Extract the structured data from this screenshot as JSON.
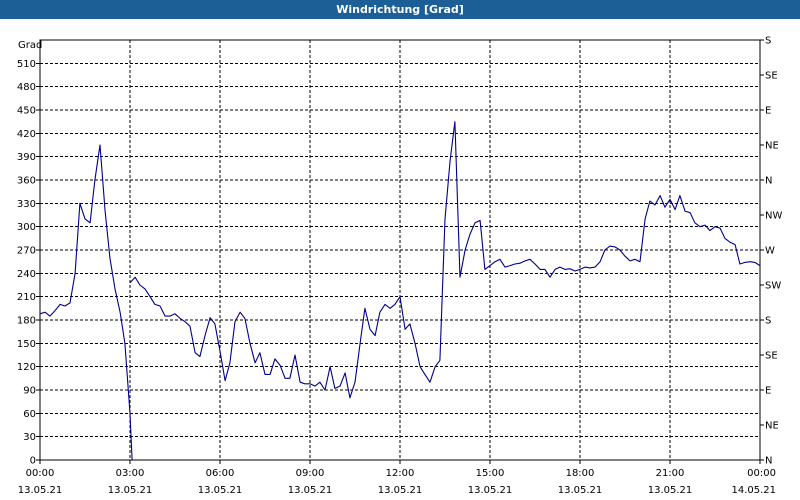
{
  "window": {
    "title": "Windrichtung [Grad]"
  },
  "chart_data": {
    "type": "line",
    "title": "Windrichtung [Grad]",
    "ylabel": "Grad",
    "ylim": [
      0,
      540
    ],
    "xlim_hours": [
      0,
      24
    ],
    "grid": true,
    "line_color": "#00008b",
    "y_ticks": [
      0,
      30,
      60,
      90,
      120,
      150,
      180,
      210,
      240,
      270,
      300,
      330,
      360,
      390,
      420,
      450,
      480,
      510
    ],
    "right_ticks": [
      {
        "value": 0,
        "label": "N"
      },
      {
        "value": 45,
        "label": "NE"
      },
      {
        "value": 90,
        "label": "E"
      },
      {
        "value": 135,
        "label": "SE"
      },
      {
        "value": 180,
        "label": "S"
      },
      {
        "value": 225,
        "label": "SW"
      },
      {
        "value": 270,
        "label": "W"
      },
      {
        "value": 315,
        "label": "NW"
      },
      {
        "value": 360,
        "label": "N"
      },
      {
        "value": 405,
        "label": "NE"
      },
      {
        "value": 450,
        "label": "E"
      },
      {
        "value": 495,
        "label": "SE"
      },
      {
        "value": 540,
        "label": "S"
      }
    ],
    "x_ticks": [
      {
        "hour": 0,
        "time": "00:00",
        "date": "13.05.21"
      },
      {
        "hour": 3,
        "time": "03:00",
        "date": "13.05.21"
      },
      {
        "hour": 6,
        "time": "06:00",
        "date": "13.05.21"
      },
      {
        "hour": 9,
        "time": "09:00",
        "date": "13.05.21"
      },
      {
        "hour": 12,
        "time": "12:00",
        "date": "13.05.21"
      },
      {
        "hour": 15,
        "time": "15:00",
        "date": "13.05.21"
      },
      {
        "hour": 18,
        "time": "18:00",
        "date": "13.05.21"
      },
      {
        "hour": 21,
        "time": "21:00",
        "date": "13.05.21"
      },
      {
        "hour": 24,
        "time": "00:00",
        "date": "14.05.21"
      }
    ],
    "series": [
      {
        "points": [
          [
            0.0,
            188
          ],
          [
            0.17,
            190
          ],
          [
            0.33,
            185
          ],
          [
            0.5,
            192
          ],
          [
            0.67,
            200
          ],
          [
            0.83,
            198
          ],
          [
            1.0,
            202
          ],
          [
            1.17,
            240
          ],
          [
            1.33,
            330
          ],
          [
            1.5,
            310
          ],
          [
            1.67,
            305
          ],
          [
            1.83,
            360
          ],
          [
            2.0,
            405
          ],
          [
            2.17,
            320
          ],
          [
            2.33,
            260
          ],
          [
            2.5,
            220
          ],
          [
            2.67,
            190
          ],
          [
            2.83,
            150
          ],
          [
            3.0,
            60
          ],
          [
            3.07,
            0
          ]
        ]
      },
      {
        "points": [
          [
            3.0,
            228
          ],
          [
            3.17,
            235
          ],
          [
            3.33,
            225
          ],
          [
            3.5,
            220
          ],
          [
            3.67,
            210
          ],
          [
            3.83,
            200
          ],
          [
            4.0,
            198
          ],
          [
            4.17,
            185
          ],
          [
            4.33,
            185
          ],
          [
            4.5,
            188
          ],
          [
            4.67,
            182
          ],
          [
            4.83,
            178
          ],
          [
            5.0,
            172
          ],
          [
            5.17,
            138
          ],
          [
            5.33,
            133
          ],
          [
            5.5,
            160
          ],
          [
            5.67,
            183
          ],
          [
            5.83,
            175
          ],
          [
            6.0,
            140
          ],
          [
            6.17,
            102
          ],
          [
            6.33,
            125
          ],
          [
            6.5,
            178
          ],
          [
            6.67,
            190
          ],
          [
            6.83,
            182
          ],
          [
            7.0,
            150
          ],
          [
            7.17,
            125
          ],
          [
            7.33,
            138
          ],
          [
            7.5,
            110
          ],
          [
            7.67,
            110
          ],
          [
            7.83,
            130
          ],
          [
            8.0,
            122
          ],
          [
            8.17,
            105
          ],
          [
            8.33,
            105
          ],
          [
            8.5,
            135
          ],
          [
            8.67,
            100
          ],
          [
            8.83,
            98
          ],
          [
            9.0,
            98
          ],
          [
            9.17,
            95
          ],
          [
            9.33,
            100
          ],
          [
            9.5,
            90
          ],
          [
            9.67,
            120
          ],
          [
            9.83,
            92
          ],
          [
            10.0,
            95
          ],
          [
            10.17,
            112
          ],
          [
            10.33,
            80
          ],
          [
            10.5,
            100
          ],
          [
            10.67,
            150
          ],
          [
            10.83,
            195
          ],
          [
            11.0,
            168
          ],
          [
            11.17,
            160
          ],
          [
            11.33,
            190
          ],
          [
            11.5,
            200
          ],
          [
            11.67,
            195
          ],
          [
            11.83,
            200
          ],
          [
            12.0,
            210
          ],
          [
            12.17,
            168
          ],
          [
            12.33,
            175
          ],
          [
            12.5,
            150
          ],
          [
            12.67,
            120
          ],
          [
            12.83,
            110
          ],
          [
            13.0,
            100
          ],
          [
            13.17,
            120
          ],
          [
            13.33,
            128
          ],
          [
            13.5,
            310
          ],
          [
            13.67,
            385
          ],
          [
            13.83,
            435
          ],
          [
            14.0,
            235
          ],
          [
            14.17,
            270
          ],
          [
            14.33,
            290
          ],
          [
            14.5,
            305
          ],
          [
            14.67,
            308
          ],
          [
            14.83,
            245
          ],
          [
            15.0,
            250
          ],
          [
            15.17,
            255
          ],
          [
            15.33,
            258
          ],
          [
            15.5,
            248
          ],
          [
            15.67,
            250
          ],
          [
            15.83,
            252
          ],
          [
            16.0,
            253
          ],
          [
            16.17,
            256
          ],
          [
            16.33,
            258
          ],
          [
            16.5,
            252
          ],
          [
            16.67,
            245
          ],
          [
            16.83,
            245
          ],
          [
            17.0,
            235
          ],
          [
            17.17,
            245
          ],
          [
            17.33,
            248
          ],
          [
            17.5,
            245
          ],
          [
            17.67,
            246
          ],
          [
            17.83,
            243
          ],
          [
            18.0,
            245
          ],
          [
            18.17,
            248
          ],
          [
            18.33,
            247
          ],
          [
            18.5,
            248
          ],
          [
            18.67,
            255
          ],
          [
            18.83,
            270
          ],
          [
            19.0,
            275
          ],
          [
            19.17,
            274
          ],
          [
            19.33,
            270
          ],
          [
            19.5,
            262
          ],
          [
            19.67,
            256
          ],
          [
            19.83,
            258
          ],
          [
            20.0,
            255
          ],
          [
            20.17,
            310
          ],
          [
            20.33,
            333
          ],
          [
            20.5,
            328
          ],
          [
            20.67,
            340
          ],
          [
            20.83,
            325
          ],
          [
            21.0,
            335
          ],
          [
            21.17,
            322
          ],
          [
            21.33,
            340
          ],
          [
            21.5,
            320
          ],
          [
            21.67,
            318
          ],
          [
            21.83,
            305
          ],
          [
            22.0,
            300
          ],
          [
            22.17,
            302
          ],
          [
            22.33,
            295
          ],
          [
            22.5,
            300
          ],
          [
            22.67,
            298
          ],
          [
            22.83,
            285
          ],
          [
            23.0,
            280
          ],
          [
            23.17,
            277
          ],
          [
            23.33,
            252
          ],
          [
            23.5,
            254
          ],
          [
            23.67,
            255
          ],
          [
            23.83,
            254
          ],
          [
            24.0,
            250
          ],
          [
            24.17,
            245
          ],
          [
            24.33,
            248
          ],
          [
            24.5,
            246
          ]
        ]
      }
    ]
  }
}
